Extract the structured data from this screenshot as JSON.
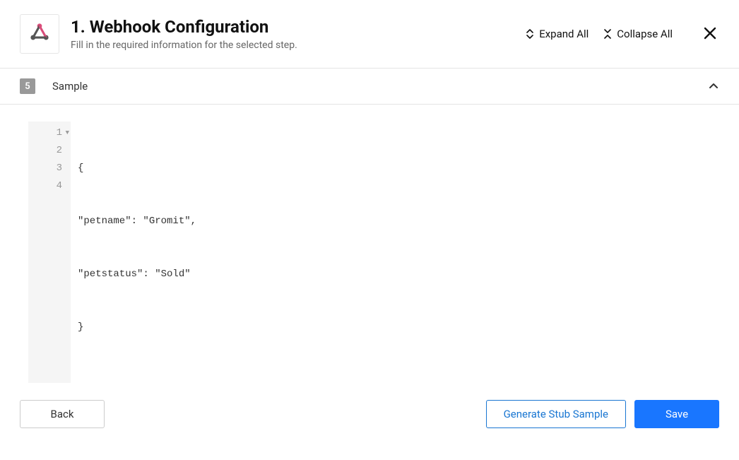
{
  "header": {
    "title": "1. Webhook Configuration",
    "subtitle": "Fill in the required information for the selected step.",
    "expand_label": "Expand All",
    "collapse_label": "Collapse All"
  },
  "section": {
    "number": "5",
    "title": "Sample"
  },
  "code": {
    "lines": [
      "{",
      "\"petname\": \"Gromit\",",
      "\"petstatus\": \"Sold\"",
      "}"
    ],
    "line_numbers": [
      "1",
      "2",
      "3",
      "4"
    ]
  },
  "footer": {
    "back_label": "Back",
    "generate_label": "Generate Stub Sample",
    "save_label": "Save"
  }
}
